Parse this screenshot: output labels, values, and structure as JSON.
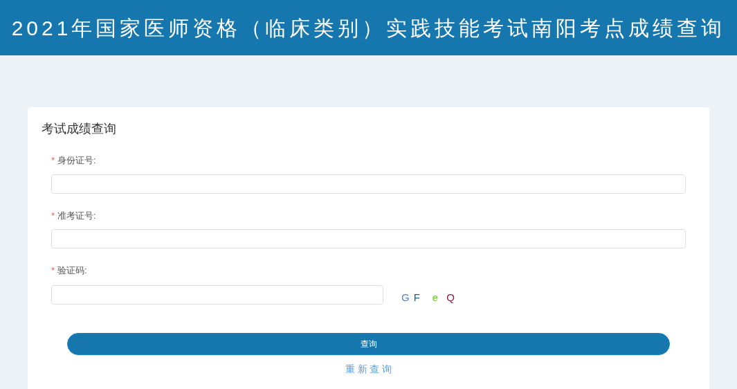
{
  "header": {
    "title": "2021年国家医师资格（临床类别）实践技能考试南阳考点成绩查询"
  },
  "form": {
    "title": "考试成绩查询",
    "fields": [
      {
        "label": "身份证号:",
        "required_mark": "*",
        "kind": "text"
      },
      {
        "label": "准考证号:",
        "required_mark": "*",
        "kind": "text"
      },
      {
        "label": "验证码:",
        "required_mark": "*",
        "kind": "captcha"
      }
    ],
    "captcha": [
      {
        "char": "G",
        "color": "#5b7fc0"
      },
      {
        "char": "F",
        "color": "#1a5f8a"
      },
      {
        "char": "e",
        "color": "#66cc22"
      },
      {
        "char": "Q",
        "color": "#8b1a3a"
      }
    ],
    "submit_button": "查询",
    "reset_link": "重 新 查 询"
  }
}
